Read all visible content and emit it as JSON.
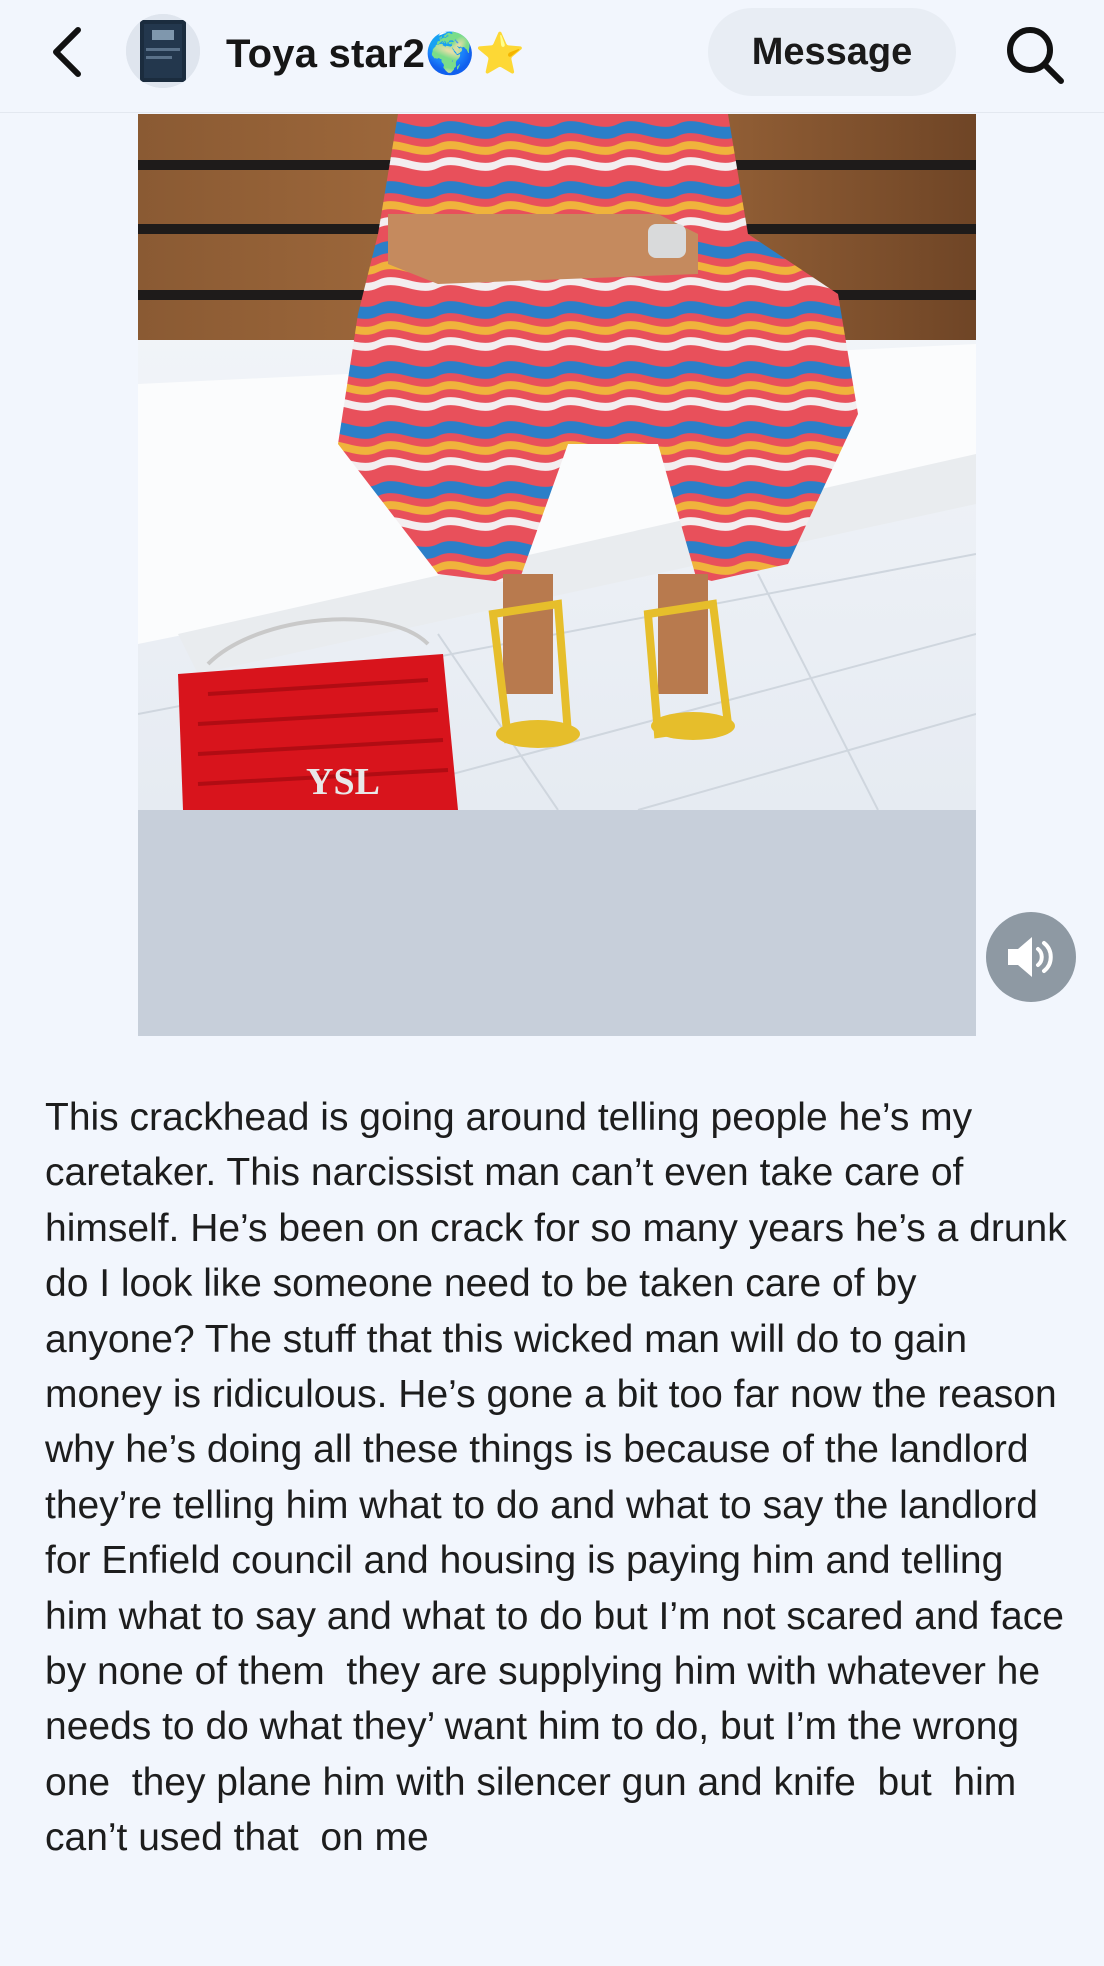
{
  "header": {
    "back_icon": "chevron-left-icon",
    "avatar_icon": "book-cover-avatar",
    "username": "Toya star2🌍⭐",
    "message_label": "Message",
    "search_icon": "search-icon"
  },
  "media": {
    "sound_icon": "speaker-icon"
  },
  "post": {
    "text": "This crackhead is going around telling people he’s my caretaker. This narcissist man can’t even take care of himself. He’s been on crack for so many years he’s a drunk do I look like someone need to be taken care of by anyone? The stuff that this wicked man will do to gain money is ridiculous. He’s gone a bit too far now the reason why he’s doing all these things is because of the landlord they’re telling him what to do and what to say the landlord for Enfield council and housing is paying him and telling   him what to say and what to do but I’m not scared and face by none of them  they are supplying him with whatever he needs to do what they’ want him to do, but I’m the wrong one  they plane him with silencer gun and knife  but  him can’t used that  on me"
  },
  "colors": {
    "background": "#f2f6fd",
    "message_button_bg": "#e8edf4",
    "sound_button_bg": "#8e99a3",
    "placeholder_gray": "#c7cfda"
  }
}
